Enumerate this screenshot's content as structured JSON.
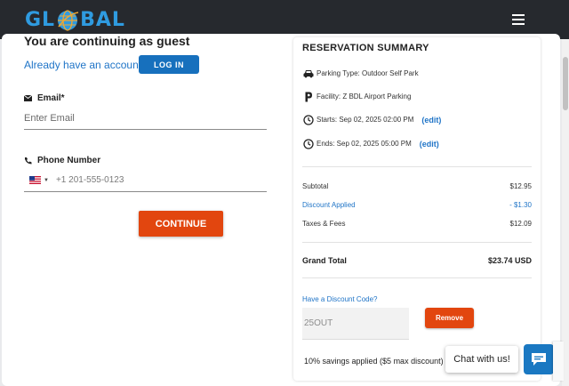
{
  "header": {
    "logo_text_left": "GL",
    "logo_text_right": "BAL",
    "menu_icon": "hamburger-menu-icon"
  },
  "guest": {
    "title": "You are continuing as guest",
    "have_account": "Already have an account?",
    "login_label": "LOG IN"
  },
  "form": {
    "email_label": "Email*",
    "email_placeholder": "Enter Email",
    "phone_label": "Phone Number",
    "phone_placeholder": "+1 201-555-0123",
    "continue_label": "CONTINUE"
  },
  "summary": {
    "title": "RESERVATION SUMMARY",
    "parking_type": "Parking Type: Outdoor Self Park",
    "facility": "Facility: Z BDL Airport Parking",
    "starts": "Starts: Sep 02, 2025 02:00 PM",
    "ends": "Ends: Sep 02, 2025 05:00 PM",
    "edit_label": "(edit)",
    "subtotal_label": "Subtotal",
    "subtotal_value": "$12.95",
    "discount_label": "Discount Applied",
    "discount_value": "- $1.30",
    "taxes_label": "Taxes & Fees",
    "taxes_value": "$12.09",
    "grand_total_label": "Grand Total",
    "grand_total_value": "$23.74 USD",
    "discount_question": "Have a Discount Code?",
    "discount_code": "25OUT",
    "remove_label": "Remove",
    "savings_note": "10% savings applied ($5 max discount)"
  },
  "chat": {
    "label": "Chat with us!"
  },
  "colors": {
    "accent_orange": "#e2460f",
    "link_blue": "#1f74c7",
    "header_bg": "#26292e"
  }
}
